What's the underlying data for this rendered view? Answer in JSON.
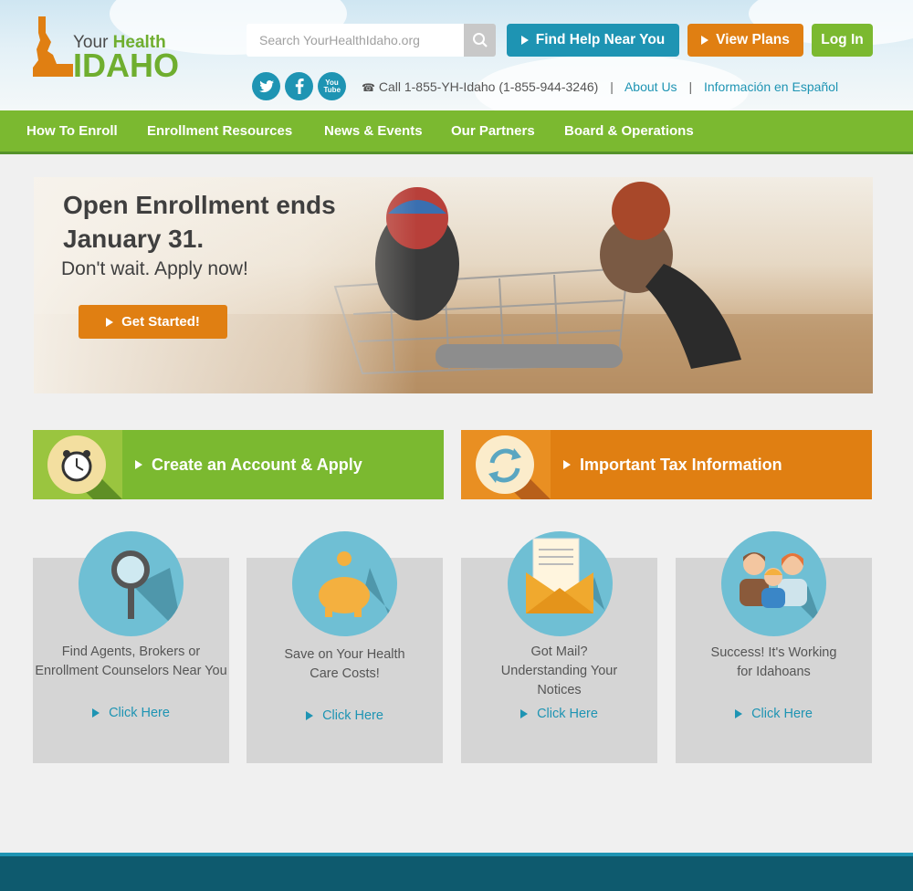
{
  "brand": {
    "line1_a": "Your",
    "line1_b": "Health",
    "line2": "IDAHO"
  },
  "search": {
    "placeholder": "Search YourHealthIdaho.org"
  },
  "header_buttons": {
    "find_help": "Find Help Near You",
    "view_plans": "View Plans",
    "login": "Log In"
  },
  "social": {
    "twitter": "twitter-icon",
    "facebook": "facebook-icon",
    "youtube": "youtube-icon",
    "youtube_text": "You Tube"
  },
  "contact": {
    "phone": "Call 1-855-YH-Idaho (1-855-944-3246)",
    "about": "About Us",
    "spanish": "Información en Español"
  },
  "nav": [
    "How To Enroll",
    "Enrollment Resources",
    "News & Events",
    "Our Partners",
    "Board & Operations"
  ],
  "hero": {
    "title_line1": "Open Enrollment ends",
    "title_line2": "January 31.",
    "subtitle": "Don't wait. Apply now!",
    "cta": "Get Started!"
  },
  "actions": {
    "create": "Create an Account & Apply",
    "tax": "Important Tax Information"
  },
  "cards": [
    {
      "text": "Find Agents, Brokers or Enrollment Counselors Near You",
      "link": "Click Here"
    },
    {
      "text": "Save on Your Health Care Costs!",
      "link": "Click Here"
    },
    {
      "text": "Got Mail? Understanding Your Notices",
      "link": "Click Here"
    },
    {
      "text": "Success! It's Working for Idahoans",
      "link": "Click Here"
    }
  ],
  "colors": {
    "green": "#7bb930",
    "orange": "#e07f12",
    "blue": "#1e94b3",
    "footer": "#0e5a6e"
  }
}
